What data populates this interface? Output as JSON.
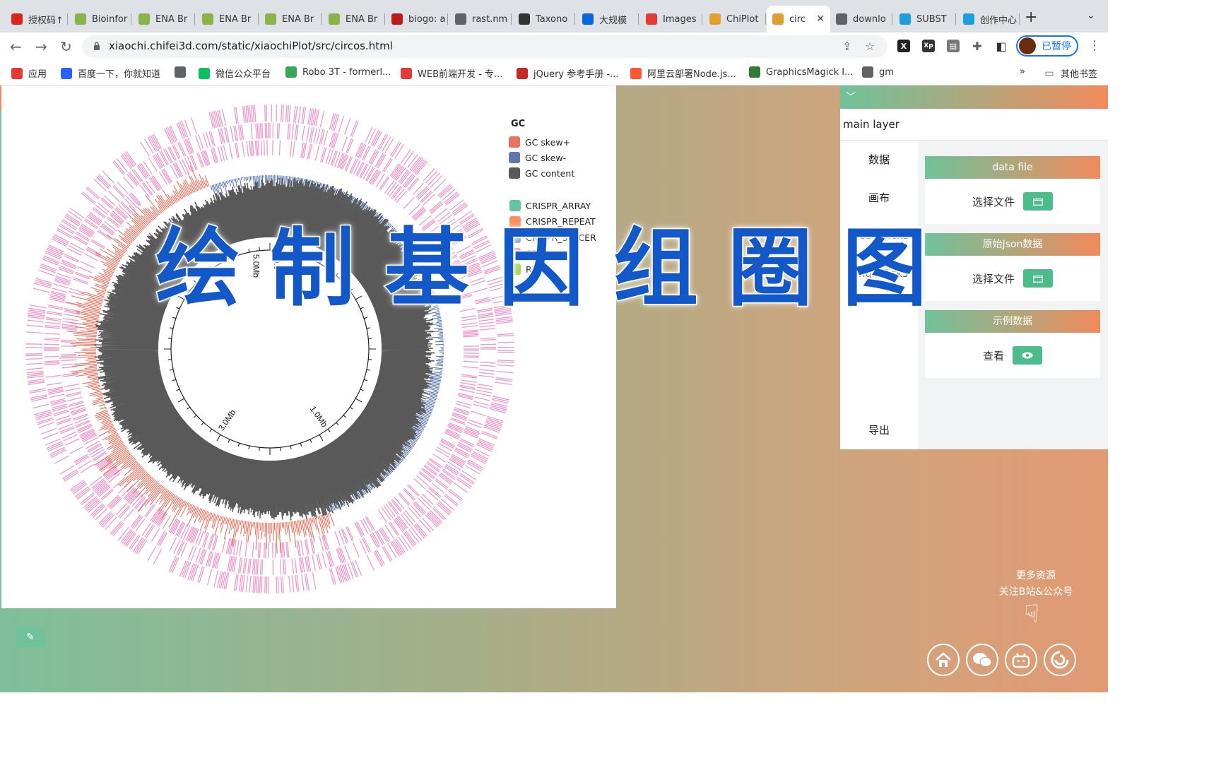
{
  "browser": {
    "tabs": [
      {
        "label": "授权码↑",
        "icon": "huawei-icon",
        "color": "#d9261c"
      },
      {
        "label": "Bioinfor",
        "icon": "hexagon-icon",
        "color": "#8ab34a"
      },
      {
        "label": "ENA Br",
        "icon": "hexagon-icon",
        "color": "#8ab34a"
      },
      {
        "label": "ENA Br",
        "icon": "hexagon-icon",
        "color": "#8ab34a"
      },
      {
        "label": "ENA Br",
        "icon": "hexagon-icon",
        "color": "#8ab34a"
      },
      {
        "label": "ENA Br",
        "icon": "hexagon-icon",
        "color": "#8ab34a"
      },
      {
        "label": "biogo: a",
        "icon": "br-icon",
        "color": "#b91c1c"
      },
      {
        "label": "rast.nm",
        "icon": "globe-icon",
        "color": "#5f6368"
      },
      {
        "label": "Taxono",
        "icon": "dna-icon",
        "color": "#333333"
      },
      {
        "label": "大规模",
        "icon": "zhihu-icon",
        "color": "#0a66dc"
      },
      {
        "label": "Images",
        "icon": "circle-icon",
        "color": "#e53935"
      },
      {
        "label": "ChiPlot",
        "icon": "chiplot-icon",
        "color": "#e0a030"
      },
      {
        "label": "circ",
        "icon": "chiplot-icon",
        "color": "#e0a030",
        "active": true
      },
      {
        "label": "downlo",
        "icon": "globe-icon",
        "color": "#5f6368"
      },
      {
        "label": "SUBST",
        "icon": "bilibili-icon",
        "color": "#1aa0e0"
      },
      {
        "label": "创作中心",
        "icon": "bilibili-icon",
        "color": "#1aa0e0"
      }
    ],
    "url": "xiaochi.chifei3d.com/static/xiaochiPlot/src/circos.html",
    "profile_status": "已暂停",
    "bookmarks": [
      {
        "label": "应用",
        "icon": "apps-icon"
      },
      {
        "label": "百度一下，你就知道",
        "icon": "baidu-icon"
      },
      {
        "label": "",
        "icon": "globe-icon"
      },
      {
        "label": "微信公众平台",
        "icon": "wechat-icon"
      },
      {
        "label": "Robo 3T - formerl...",
        "icon": "robo-icon"
      },
      {
        "label": "WEB前端开发 - 专...",
        "icon": "html-icon"
      },
      {
        "label": "jQuery 参考手册 -...",
        "icon": "jquery-icon"
      },
      {
        "label": "阿里云部署Node.js...",
        "icon": "csdn-icon"
      },
      {
        "label": "GraphicsMagick I...",
        "icon": "gm-icon"
      },
      {
        "label": "gm",
        "icon": "globe-icon"
      }
    ],
    "bookmarks_more": "»",
    "other_bookmarks": "其他书签"
  },
  "plot": {
    "legend_title": "GC",
    "gc_legend": [
      {
        "label": "GC skew+",
        "color": "#e8735f"
      },
      {
        "label": "GC skew-",
        "color": "#5b77b0"
      },
      {
        "label": "GC content",
        "color": "#595959"
      }
    ],
    "feature_legend": [
      {
        "label": "CRISPR_ARRAY",
        "color": "#66c2a5"
      },
      {
        "label": "CRISPR_REPEAT",
        "color": "#fc8d62"
      },
      {
        "label": "CRISPR_SPACER",
        "color": "#8da0cb"
      },
      {
        "label": "CDS",
        "color": "#e78ac3"
      },
      {
        "label": "RNA",
        "color": "#a6d854"
      }
    ],
    "tick_labels": [
      "0.0",
      "5.0Mb",
      "3.0Mb",
      "1.0Mb"
    ]
  },
  "panel": {
    "tabs": "main  layer",
    "menu": [
      "数据",
      "画布",
      "globalTicks",
      "singleTicks",
      "导出"
    ],
    "cards": [
      {
        "title": "data file",
        "action": "选择文件"
      },
      {
        "title": "原始Json数据",
        "action": "选择文件"
      },
      {
        "title": "示例数据",
        "action": "查看"
      }
    ]
  },
  "overlay_title": "绘制基因组圈图",
  "promo": {
    "line1": "更多资源",
    "line2": "关注B站&公众号"
  }
}
